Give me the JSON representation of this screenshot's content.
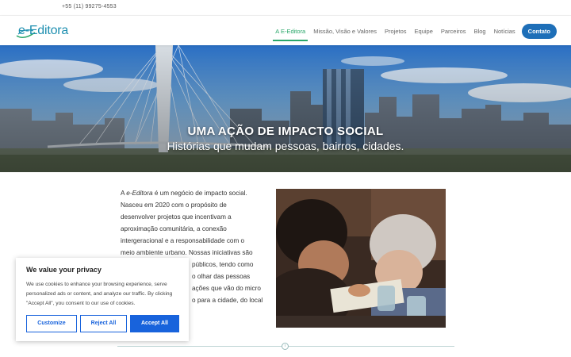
{
  "topbar": {
    "phone": "+55 (11) 99275-4553"
  },
  "header": {
    "logo_text": "e-Editora",
    "nav": [
      {
        "label": "A E-Editora",
        "active": true
      },
      {
        "label": "Missão, Visão e Valores"
      },
      {
        "label": "Projetos"
      },
      {
        "label": "Equipe"
      },
      {
        "label": "Parceiros"
      },
      {
        "label": "Blog"
      },
      {
        "label": "Notícias"
      }
    ],
    "contact_label": "Contato"
  },
  "hero": {
    "title": "UMA AÇÃO DE IMPACTO SOCIAL",
    "subtitle": "Histórias que mudam pessoas, bairros, cidades."
  },
  "intro": {
    "brand": "e-Editora",
    "lines": [
      "é um negócio de impacto social.",
      "Nasceu em 2020 com o propósito de",
      "desenvolver projetos que incentivam a",
      "aproximação comunitária, a conexão",
      "intergeracional e a responsabilidade com o",
      "meio ambiente urbano. Nossas iniciativas são",
      "públicos, tendo como",
      "o olhar das pessoas",
      "ações que vão do micro",
      "o para a cidade, do local"
    ],
    "prefix": "A"
  },
  "cookie": {
    "title": "We value your privacy",
    "text": "We use cookies to enhance your browsing experience, serve personalized ads or content, and analyze our traffic. By clicking \"Accept All\", you consent to our use of cookies.",
    "customize": "Customize",
    "reject": "Reject All",
    "accept": "Accept All"
  },
  "colors": {
    "brand_blue": "#1e8fb0",
    "active_green": "#2aa76a",
    "contact_blue": "#1e6fb8",
    "cookie_blue": "#1863dc"
  }
}
